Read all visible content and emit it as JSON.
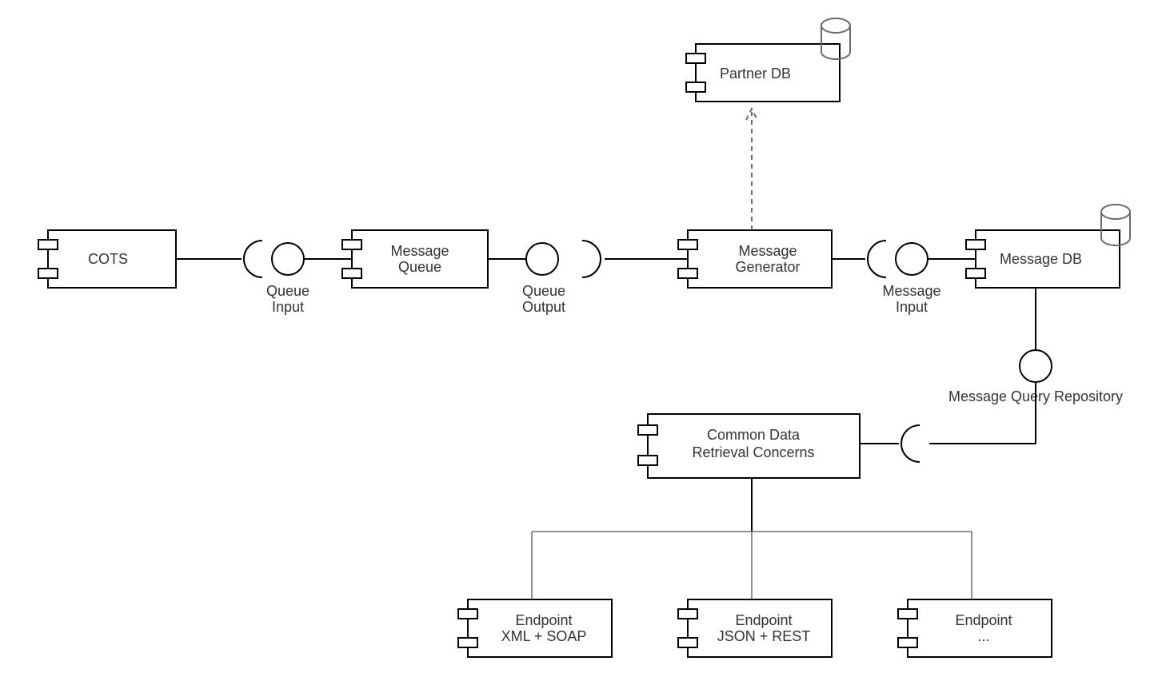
{
  "components": {
    "cots": "COTS",
    "messageQueue1": "Message",
    "messageQueue2": "Queue",
    "messageGen1": "Message",
    "messageGen2": "Generator",
    "partnerDb": "Partner DB",
    "messageDb": "Message DB",
    "common1": "Common Data",
    "common2": "Retrieval Concerns",
    "ep1a": "Endpoint",
    "ep1b": "XML + SOAP",
    "ep2a": "Endpoint",
    "ep2b": "JSON + REST",
    "ep3a": "Endpoint",
    "ep3b": "..."
  },
  "interfaces": {
    "queueInput1": "Queue",
    "queueInput2": "Input",
    "queueOutput1": "Queue",
    "queueOutput2": "Output",
    "messageInput1": "Message",
    "messageInput2": "Input",
    "mqr": "Message Query Repository"
  }
}
